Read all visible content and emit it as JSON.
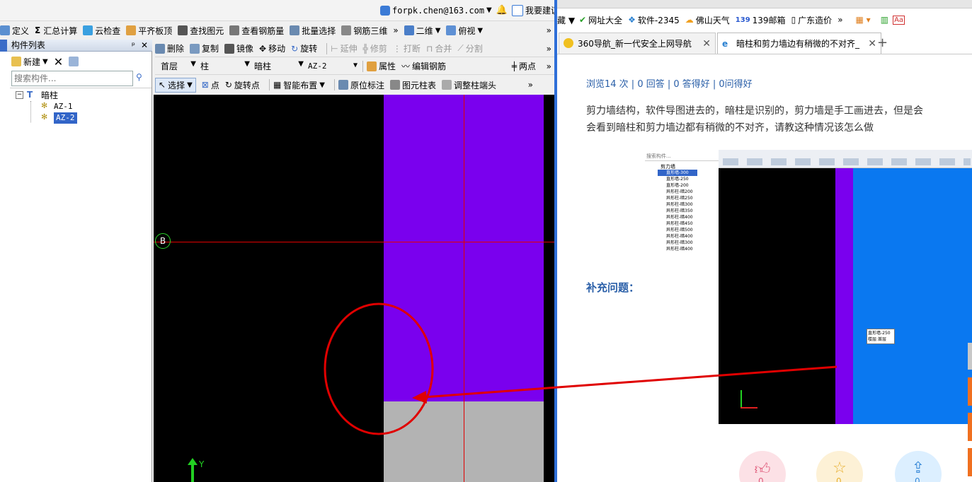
{
  "app": {
    "account": {
      "email": "forpk.chen@163.com",
      "suggest_label": "我要建议"
    },
    "toolbar1": {
      "items": [
        "定义",
        "汇总计算",
        "云检查",
        "平齐板顶",
        "查找图元",
        "查看钢筋量",
        "批量选择",
        "钢筋三维"
      ],
      "view2d": "二维",
      "viewmode": "俯视"
    },
    "toolbar2": {
      "items": [
        "删除",
        "复制",
        "镜像",
        "移动",
        "旋转",
        "延伸",
        "修剪",
        "打断",
        "合并",
        "分割"
      ]
    },
    "toolbar3": {
      "floor": "首层",
      "category": "柱",
      "type": "暗柱",
      "component": "AZ-2",
      "properties": "属性",
      "edit_rebar": "编辑钢筋",
      "two_points": "两点"
    },
    "toolbar4": {
      "items": [
        "选择",
        "点",
        "旋转点",
        "智能布置",
        "原位标注",
        "图元柱表",
        "调整柱端头"
      ]
    },
    "panel": {
      "title": "构件列表",
      "new_label": "新建",
      "search_placeholder": "搜索构件...",
      "tree_root": "暗柱",
      "tree_items": [
        "AZ-1",
        "AZ-2"
      ],
      "selected": "AZ-2"
    },
    "canvas": {
      "axis_label": "B",
      "y_axis": "Y"
    }
  },
  "browser": {
    "bookmarks": [
      "网址大全",
      "软件-2345",
      "佛山天气",
      "139邮箱",
      "广东造价"
    ],
    "tabs": [
      {
        "title": "360导航_新一代安全上网导航"
      },
      {
        "title": "暗柱和剪力墙边有稍微的不对齐_"
      }
    ],
    "stats": "浏览14 次 | 0 回答 | 0 答得好 | 0问得好",
    "question_line1": "剪力墙结构，软件导图进去的，暗柱是识别的，剪力墙是手工画进去，但是会",
    "question_line2": "会看到暗柱和剪力墙边都有稍微的不对齐，请教这种情况该怎么做",
    "supplement_label": "补充问题：",
    "screenshot": {
      "search_placeholder": "搜索构件...",
      "tree_root": "剪力墙",
      "tree_items": [
        "直形墙-300",
        "直形墙-250",
        "直形墙-200",
        "异形柱-暗200",
        "异形柱-暗250",
        "异形柱-暗300",
        "异形柱-暗350",
        "异形柱-暗400",
        "异形柱-暗450",
        "异形柱-暗500",
        "异形柱-暗400",
        "异形柱-暗300",
        "异形柱-暗400"
      ],
      "tooltip_line1": "直形墙-250",
      "tooltip_line2": "楼层:首层"
    },
    "fab_counts": [
      "0",
      "0",
      "0"
    ]
  },
  "colors": {
    "purple": "#7a00ee",
    "gray_block": "#b3b3b3",
    "red": "#e00000",
    "blue_panel": "#0a78f0"
  }
}
